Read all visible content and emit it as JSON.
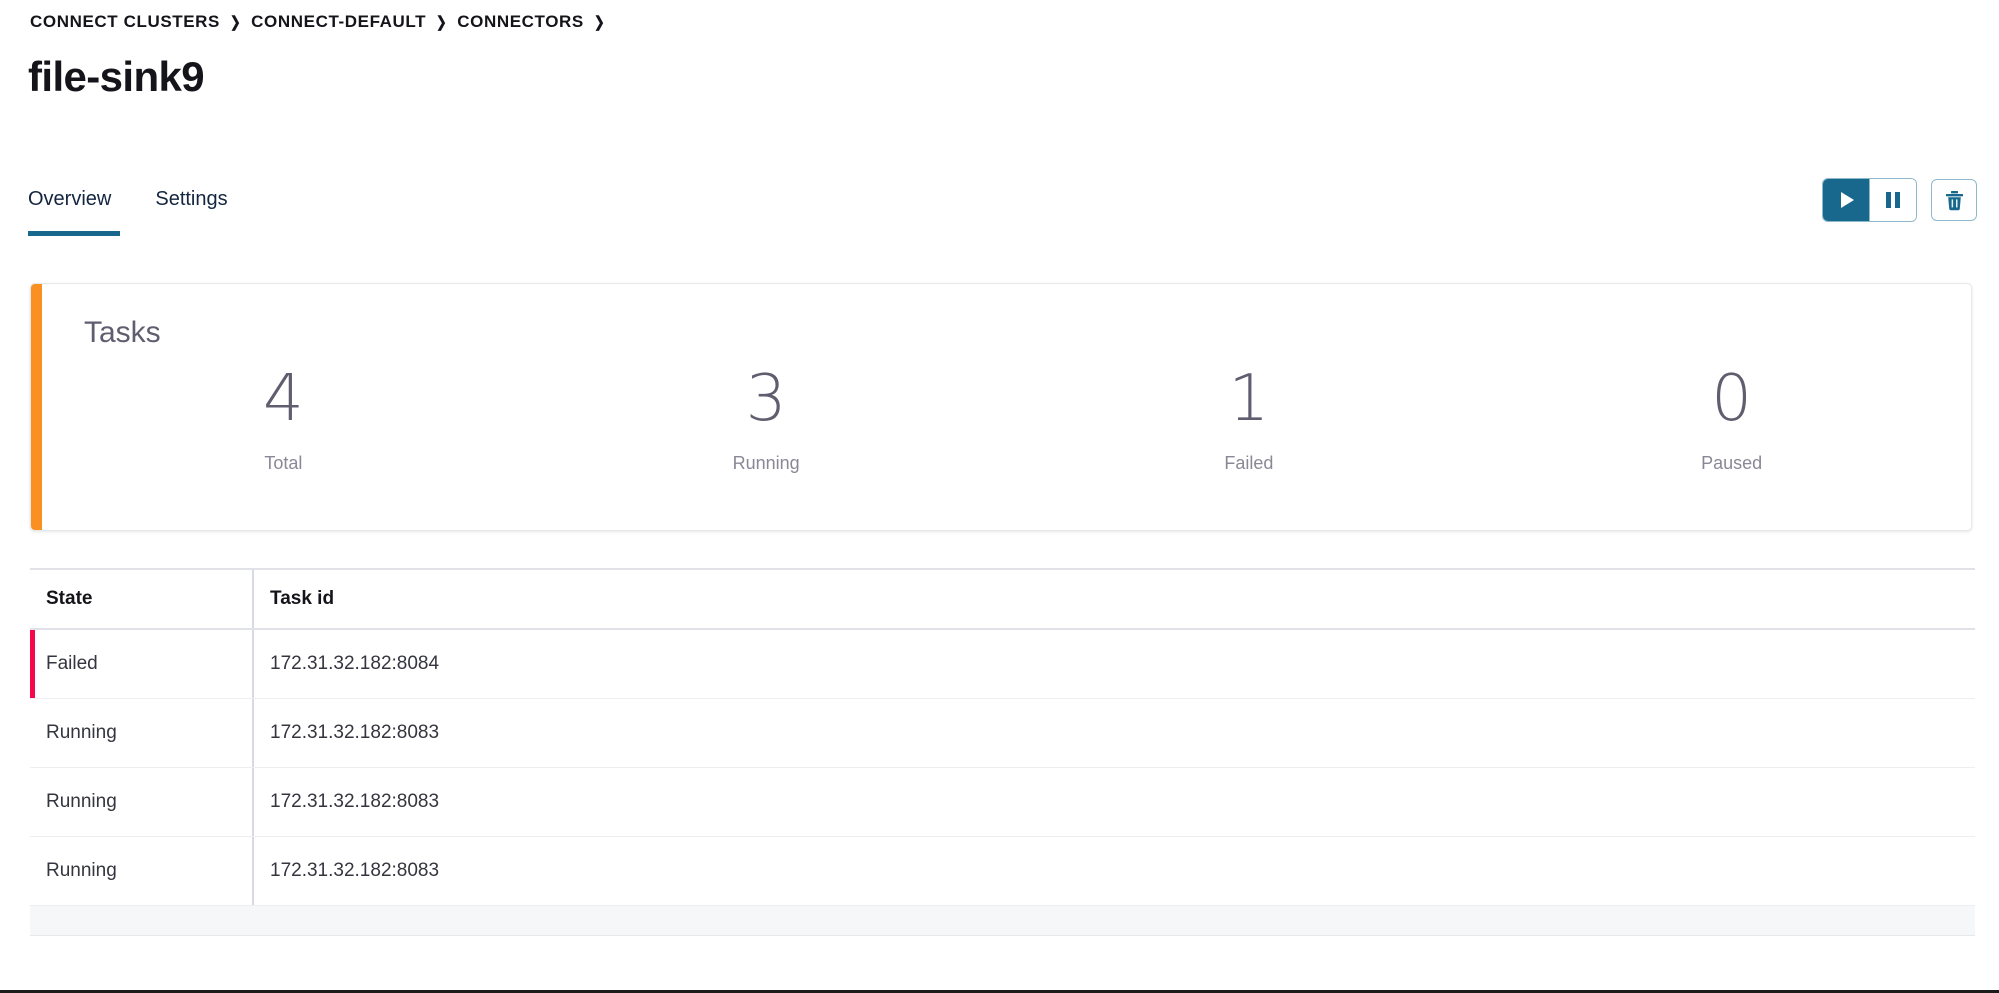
{
  "breadcrumb": {
    "items": [
      {
        "label": "CONNECT CLUSTERS"
      },
      {
        "label": "CONNECT-DEFAULT"
      },
      {
        "label": "CONNECTORS"
      }
    ],
    "separator": "❯"
  },
  "header": {
    "title": "file-sink9"
  },
  "tabs": [
    {
      "label": "Overview",
      "active": true
    },
    {
      "label": "Settings",
      "active": false
    }
  ],
  "actions": {
    "resume_label": "Resume connector",
    "resume_icon": "play-icon",
    "pause_label": "Pause connector",
    "pause_icon": "pause-icon",
    "delete_label": "Delete connector",
    "delete_icon": "trash-icon"
  },
  "tasks_card": {
    "title": "Tasks",
    "accent_color": "#fb9022",
    "stats": [
      {
        "value": "4",
        "label": "Total"
      },
      {
        "value": "3",
        "label": "Running"
      },
      {
        "value": "1",
        "label": "Failed"
      },
      {
        "value": "0",
        "label": "Paused"
      }
    ]
  },
  "tasks_table": {
    "columns": [
      {
        "key": "state",
        "label": "State"
      },
      {
        "key": "task_id",
        "label": "Task id"
      }
    ],
    "rows": [
      {
        "state": "Failed",
        "task_id": "172.31.32.182:8084",
        "accent_color": "#f5094a"
      },
      {
        "state": "Running",
        "task_id": "172.31.32.182:8083",
        "accent_color": ""
      },
      {
        "state": "Running",
        "task_id": "172.31.32.182:8083",
        "accent_color": ""
      },
      {
        "state": "Running",
        "task_id": "172.31.32.182:8083",
        "accent_color": ""
      }
    ]
  },
  "theme": {
    "accent_teal": "#17688c",
    "accent_orange": "#fb9022",
    "accent_failed": "#f5094a",
    "text_dark": "#14141a",
    "text_muted": "#5f5d6e"
  }
}
